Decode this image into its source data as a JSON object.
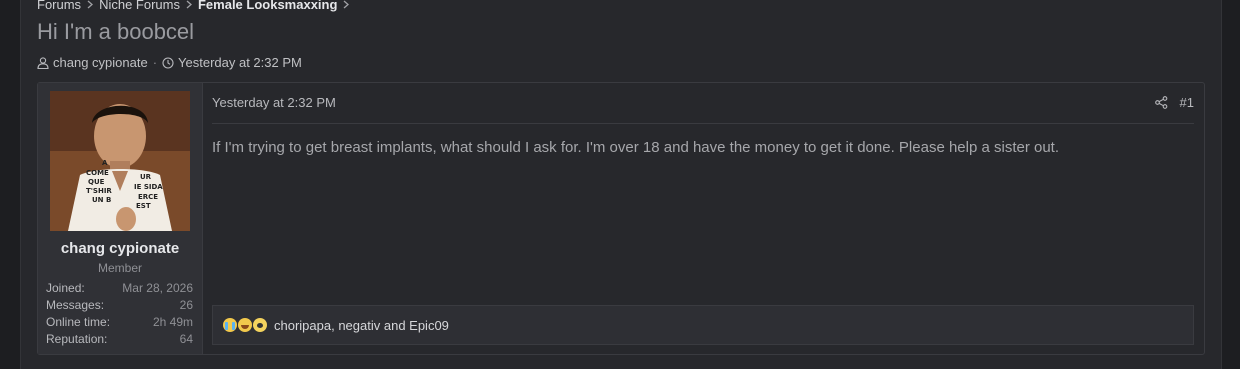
{
  "breadcrumb": {
    "items": [
      "Forums",
      "Niche Forums",
      "Female Looksmaxxing"
    ]
  },
  "thread": {
    "title": "Hi I'm a boobcel",
    "author": "chang cypionate",
    "date": "Yesterday at 2:32 PM"
  },
  "post": {
    "date": "Yesterday at 2:32 PM",
    "number": "#1",
    "body": "If I'm trying to get breast implants, what should I ask for. I'm over 18 and have the money to get it done. Please help a sister out.",
    "reactions": {
      "icons": [
        "sob-emoji",
        "joy-emoji",
        "teary-emoji"
      ],
      "users_text": "choripapa, negativ and Epic09"
    }
  },
  "user": {
    "name": "chang cypionate",
    "title": "Member",
    "avatar_text": [
      "A",
      "COME",
      "QUE",
      "T'SHIR",
      "UN B",
      "UR",
      "IE SIDA",
      "ERCE",
      "EST"
    ],
    "stats": [
      {
        "label": "Joined:",
        "value": "Mar 28, 2026"
      },
      {
        "label": "Messages:",
        "value": "26"
      },
      {
        "label": "Online time:",
        "value": "2h 49m"
      },
      {
        "label": "Reputation:",
        "value": "64"
      }
    ]
  }
}
